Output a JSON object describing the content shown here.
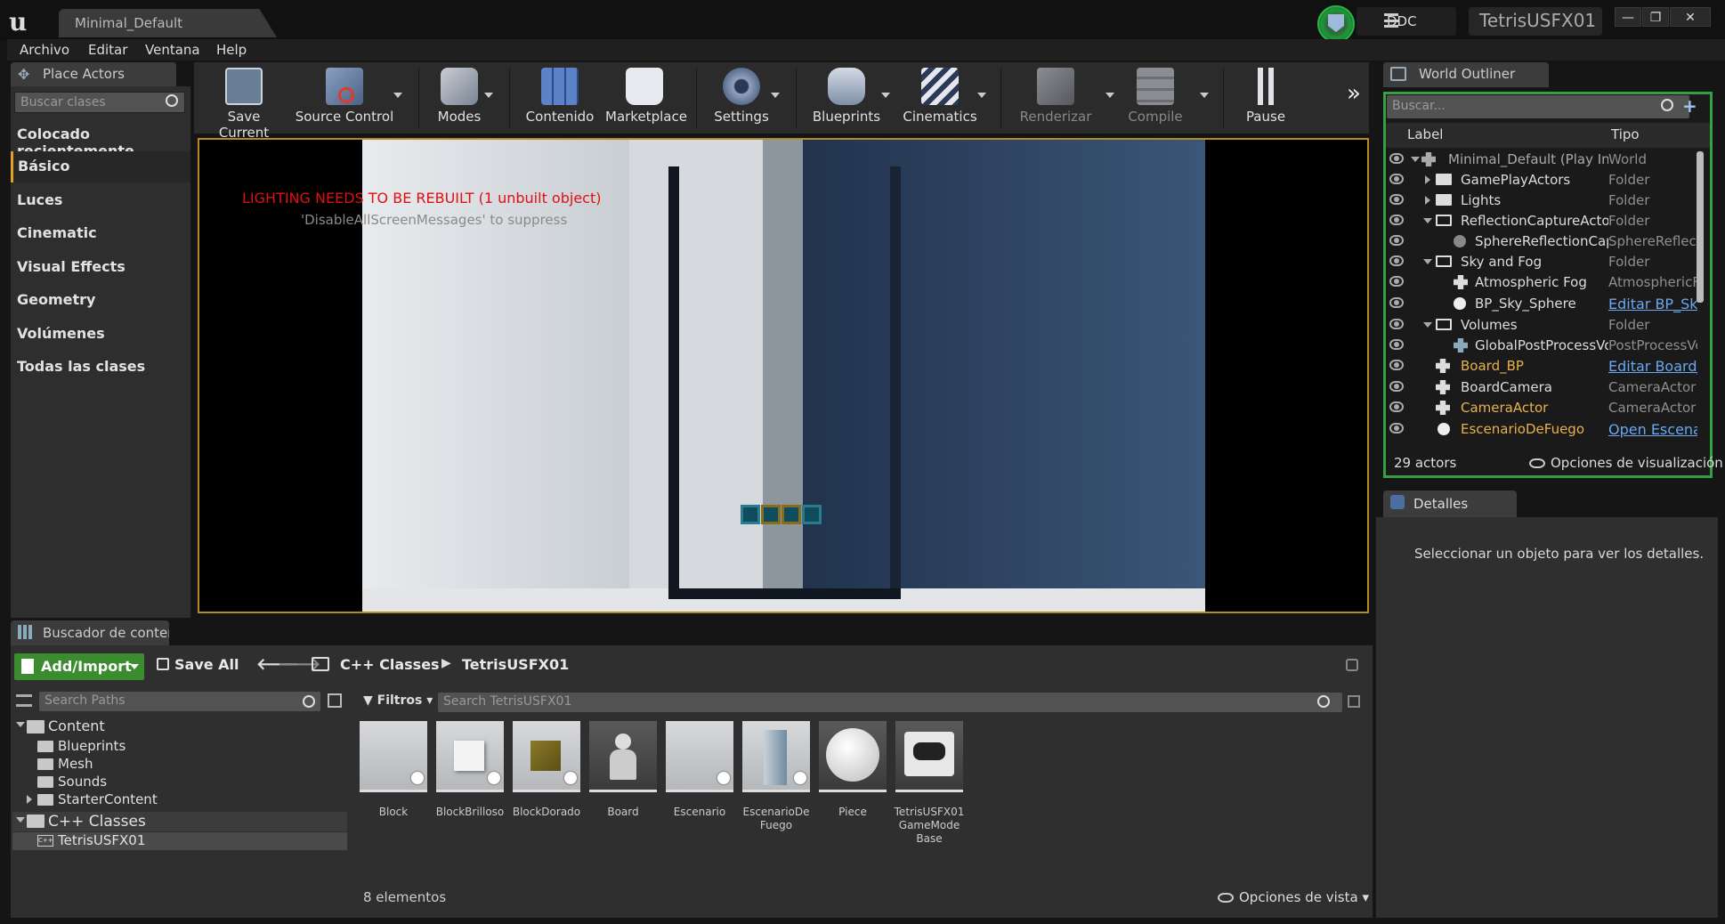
{
  "titlebar": {
    "level_tab": "Minimal_Default",
    "ddc_label": "DDC",
    "project_name": "TetrisUSFX01",
    "min_btn": "—",
    "max_btn": "❐",
    "close_btn": "✕"
  },
  "menu": [
    "Archivo",
    "Editar",
    "Ventana",
    "Help"
  ],
  "place_actors": {
    "tab_label": "Place Actors",
    "search_placeholder": "Buscar clases",
    "categories": [
      "Colocado recientemente",
      "Básico",
      "Luces",
      "Cinematic",
      "Visual Effects",
      "Geometry",
      "Volúmenes",
      "Todas las clases"
    ]
  },
  "toolbar": {
    "save_current": "Save Current",
    "source_control": "Source Control",
    "modes": "Modes",
    "contenido": "Contenido",
    "marketplace": "Marketplace",
    "settings": "Settings",
    "blueprints": "Blueprints",
    "cinematics": "Cinematics",
    "renderizar": "Renderizar",
    "compile": "Compile",
    "pause": "Pause",
    "overflow": "»"
  },
  "viewport": {
    "lighting_message": "LIGHTING NEEDS TO BE REBUILT (1 unbuilt object)",
    "suppress_message": "'DisableAllScreenMessages' to suppress"
  },
  "world_outliner": {
    "tab_label": "World Outliner",
    "search_placeholder": "Buscar...",
    "col_label": "Label",
    "col_type": "Tipo",
    "rows": [
      {
        "label": "Minimal_Default (Play In Editor)",
        "type": "World"
      },
      {
        "label": "GamePlayActors",
        "type": "Folder"
      },
      {
        "label": "Lights",
        "type": "Folder"
      },
      {
        "label": "ReflectionCaptureActors",
        "type": "Folder"
      },
      {
        "label": "SphereReflectionCapture",
        "type": "SphereReflectionCapture"
      },
      {
        "label": "Sky and Fog",
        "type": "Folder"
      },
      {
        "label": "Atmospheric Fog",
        "type": "AtmosphericFog"
      },
      {
        "label": "BP_Sky_Sphere",
        "type": "Editar BP_Sky_Sphere"
      },
      {
        "label": "Volumes",
        "type": "Folder"
      },
      {
        "label": "GlobalPostProcessVolume",
        "type": "PostProcessVolume"
      },
      {
        "label": "Board_BP",
        "type": "Editar Board_BP"
      },
      {
        "label": "BoardCamera",
        "type": "CameraActor"
      },
      {
        "label": "CameraActor",
        "type": "CameraActor"
      },
      {
        "label": "EscenarioDeFuego",
        "type": "Open EscenarioDeFuego"
      }
    ],
    "actor_count": "29 actors",
    "view_options": "Opciones de visualización"
  },
  "details": {
    "tab_label": "Detalles",
    "empty_message": "Seleccionar un objeto para ver los detalles."
  },
  "content_browser": {
    "tab_label": "Buscador de contenido",
    "add_import": "Add/Import",
    "save_all": "Save All",
    "breadcrumb": [
      "C++ Classes",
      "TetrisUSFX01"
    ],
    "paths_placeholder": "Search Paths",
    "filters_label": "Filtros",
    "assets_placeholder": "Search TetrisUSFX01",
    "tree": [
      "Content",
      "Blueprints",
      "Mesh",
      "Sounds",
      "StarterContent",
      "C++ Classes",
      "TetrisUSFX01"
    ],
    "assets": [
      "Block",
      "BlockBrilloso",
      "BlockDorado",
      "Board",
      "Escenario",
      "EscenarioDe\nFuego",
      "Piece",
      "TetrisUSFX01\nGameMode\nBase"
    ],
    "item_count": "8 elementos",
    "view_options": "Opciones de vista"
  }
}
